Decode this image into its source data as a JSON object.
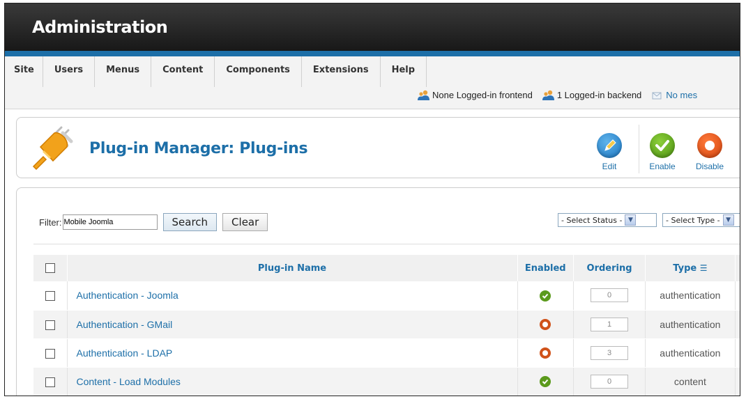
{
  "header": {
    "title": "Administration"
  },
  "menu": [
    "Site",
    "Users",
    "Menus",
    "Content",
    "Components",
    "Extensions",
    "Help"
  ],
  "status": {
    "frontend": "None Logged-in frontend",
    "backend": "1 Logged-in backend",
    "messages": "No mes"
  },
  "toolbar": {
    "page_title": "Plug-in Manager: Plug-ins",
    "edit_label": "Edit",
    "enable_label": "Enable",
    "disable_label": "Disable"
  },
  "filter": {
    "label": "Filter:",
    "value": "Mobile Joomla",
    "search_label": "Search",
    "clear_label": "Clear",
    "status_select": "- Select Status -",
    "type_select": "- Select Type -"
  },
  "columns": {
    "name": "Plug-in Name",
    "enabled": "Enabled",
    "ordering": "Ordering",
    "type": "Type"
  },
  "rows": [
    {
      "name": "Authentication - Joomla",
      "enabled": true,
      "ordering": "0",
      "type": "authentication"
    },
    {
      "name": "Authentication - GMail",
      "enabled": false,
      "ordering": "1",
      "type": "authentication"
    },
    {
      "name": "Authentication - LDAP",
      "enabled": false,
      "ordering": "3",
      "type": "authentication"
    },
    {
      "name": "Content - Load Modules",
      "enabled": true,
      "ordering": "0",
      "type": "content"
    }
  ],
  "colors": {
    "accent": "#1d6fa8",
    "enabled": "#5b9a1c",
    "disabled": "#d0521a",
    "header_bg": "#1e1e1e"
  }
}
